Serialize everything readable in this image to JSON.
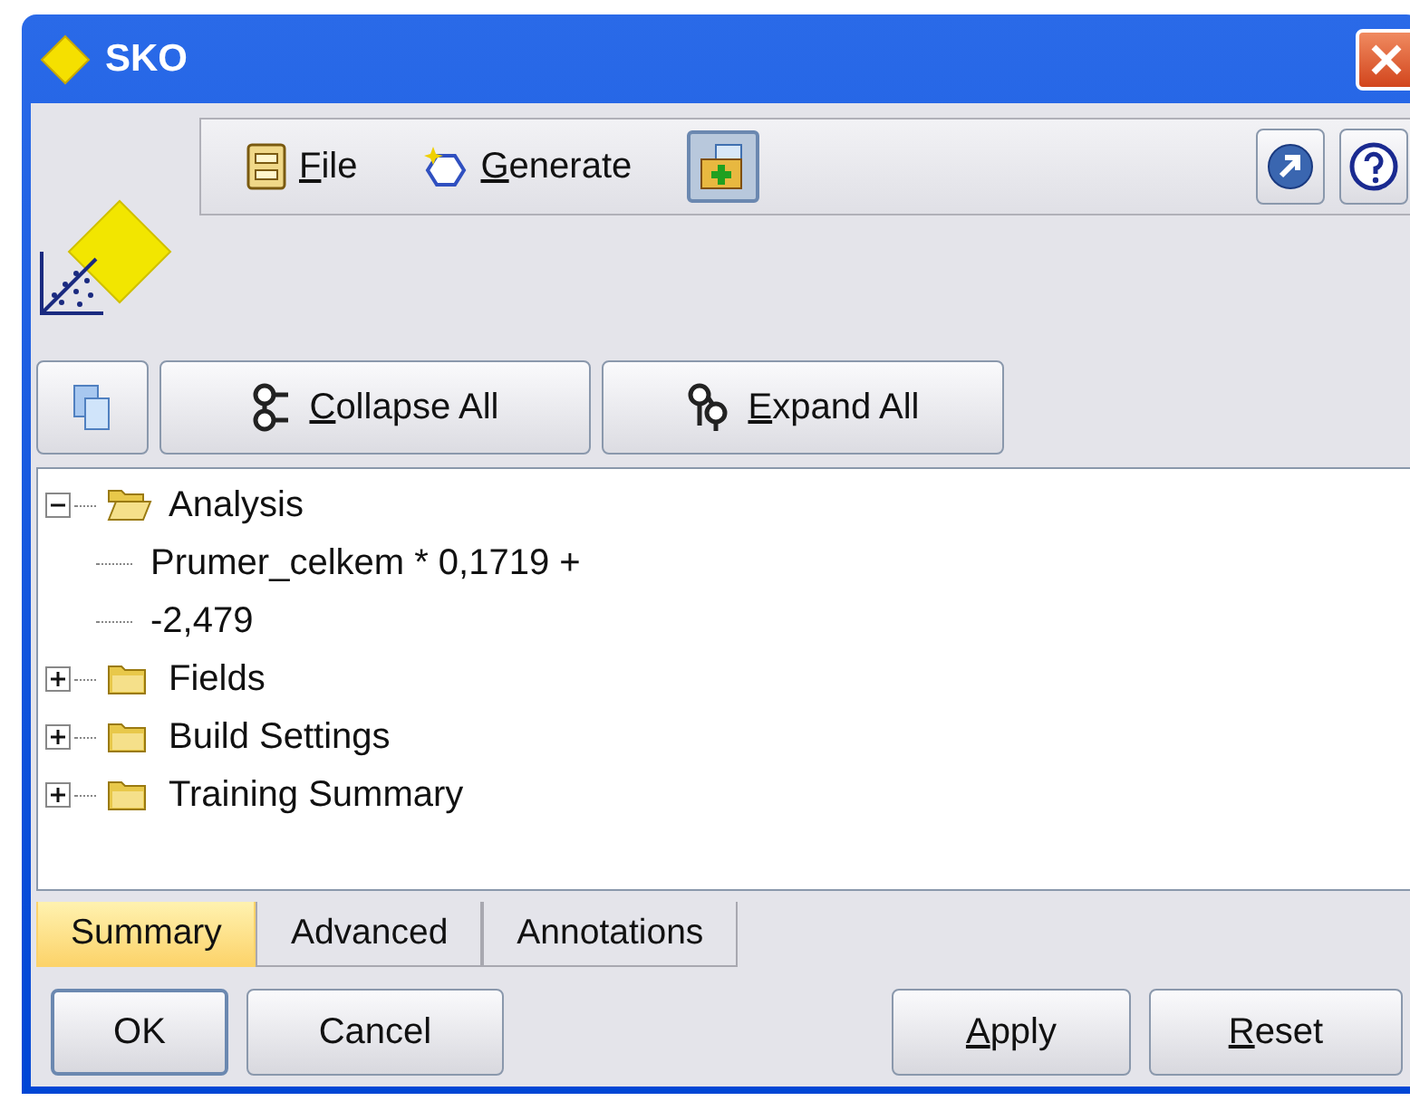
{
  "window": {
    "title": "SKO"
  },
  "toolbar": {
    "menus": [
      {
        "kind": "file",
        "label": "File",
        "mnemonic_underlined": true
      },
      {
        "kind": "generate",
        "label": "Generate",
        "mnemonic_underlined": true
      }
    ],
    "preview_pressed": true
  },
  "actions": [
    {
      "kind": "copy"
    },
    {
      "kind": "collapse",
      "label": "Collapse All",
      "mnemonic_underlined": true
    },
    {
      "kind": "expand",
      "label": "Expand All",
      "mnemonic_underlined": true
    }
  ],
  "tree": [
    {
      "label": "Analysis",
      "expanded": true,
      "children": [
        {
          "label": "Prumer_celkem * 0,1719 +"
        },
        {
          "label": "-2,479"
        }
      ]
    },
    {
      "label": "Fields",
      "expanded": false
    },
    {
      "label": "Build Settings",
      "expanded": false
    },
    {
      "label": "Training Summary",
      "expanded": false
    }
  ],
  "tabs": [
    {
      "label": "Summary",
      "selected": true
    },
    {
      "label": "Advanced",
      "selected": false
    },
    {
      "label": "Annotations",
      "selected": false
    }
  ],
  "buttons": [
    {
      "label": "OK",
      "default": true,
      "mnemonic_underlined": false
    },
    {
      "label": "Cancel",
      "default": false,
      "mnemonic_underlined": false
    },
    {
      "label": "Apply",
      "default": false,
      "mnemonic_underlined": true
    },
    {
      "label": "Reset",
      "default": false,
      "mnemonic_underlined": true
    }
  ]
}
